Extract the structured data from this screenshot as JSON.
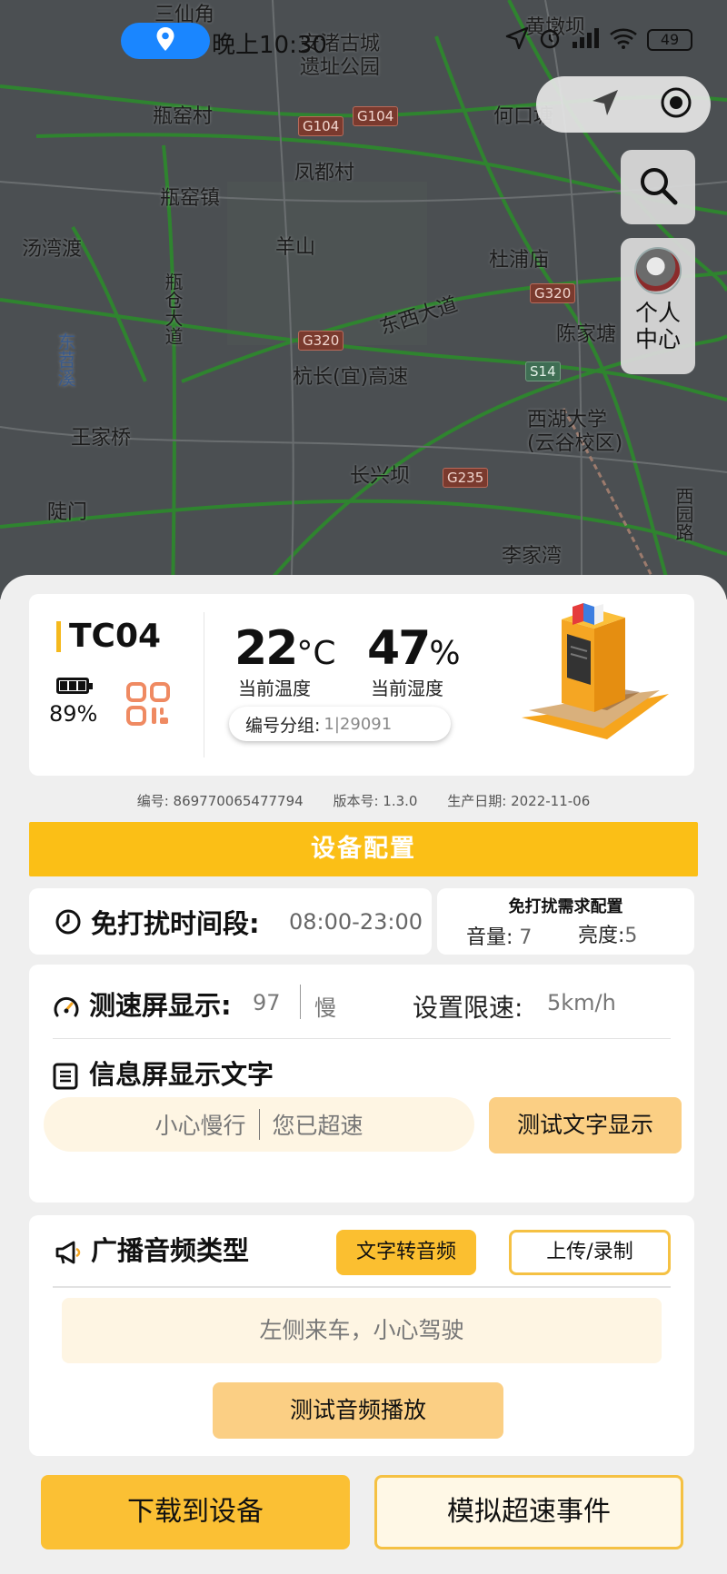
{
  "map": {
    "labels": [
      "三仙角",
      "安渚古城",
      "遗址公园",
      "黄墩坝",
      "瓶窑村",
      "何口塘",
      "凤都村",
      "瓶窑镇",
      "汤湾渡",
      "羊山",
      "杜浦庙",
      "瓶仓大道",
      "东西大道",
      "东苕溪",
      "陈家塘",
      "杭长(宜)高速",
      "西湖大学",
      "(云谷校区)",
      "王家桥",
      "长兴坝",
      "陡门",
      "李家湾",
      "西园路"
    ],
    "road_shields": [
      "G104",
      "G104",
      "G320",
      "G320",
      "S14",
      "G235"
    ]
  },
  "status_bar": {
    "time": "晚上10:30",
    "battery": "49"
  },
  "map_controls": {
    "profile_label": "个人中心"
  },
  "device": {
    "name": "TC04",
    "battery_percent": "89%",
    "temperature_value": "22",
    "temperature_unit": "°C",
    "temperature_label": "当前温度",
    "humidity_value": "47",
    "humidity_unit": "%",
    "humidity_label": "当前湿度",
    "group_label": "编号分组:",
    "group_value": "1|29091"
  },
  "meta": {
    "serial": "编号: 869770065477794",
    "version": "版本号: 1.3.0",
    "production_date": "生产日期: 2022-11-06"
  },
  "config_button": "设备配置",
  "dnd": {
    "title": "免打扰时间段:",
    "time": "08:00-23:00",
    "config_title": "免打扰需求配置",
    "volume_label": "音量:",
    "volume_value": "7",
    "brightness_label": "亮度:",
    "brightness_value": "5"
  },
  "speed": {
    "title": "测速屏显示:",
    "value": "97",
    "status": "慢",
    "limit_label": "设置限速:",
    "limit_value": "5km/h"
  },
  "info_screen": {
    "title": "信息屏显示文字",
    "text_1": "小心慢行",
    "text_2": "您已超速",
    "test_button": "测试文字显示"
  },
  "broadcast": {
    "title": "广播音频类型",
    "tts_button": "文字转音频",
    "upload_button": "上传/录制",
    "text": "左侧来车，小心驾驶",
    "test_button": "测试音频播放"
  },
  "bottom": {
    "download_button": "下载到设备",
    "simulate_button": "模拟超速事件"
  },
  "colors": {
    "accent": "#fbbf16",
    "accent_light": "#fbcf84",
    "input_bg": "#fef5e3",
    "location_blue": "#1a86ff"
  }
}
